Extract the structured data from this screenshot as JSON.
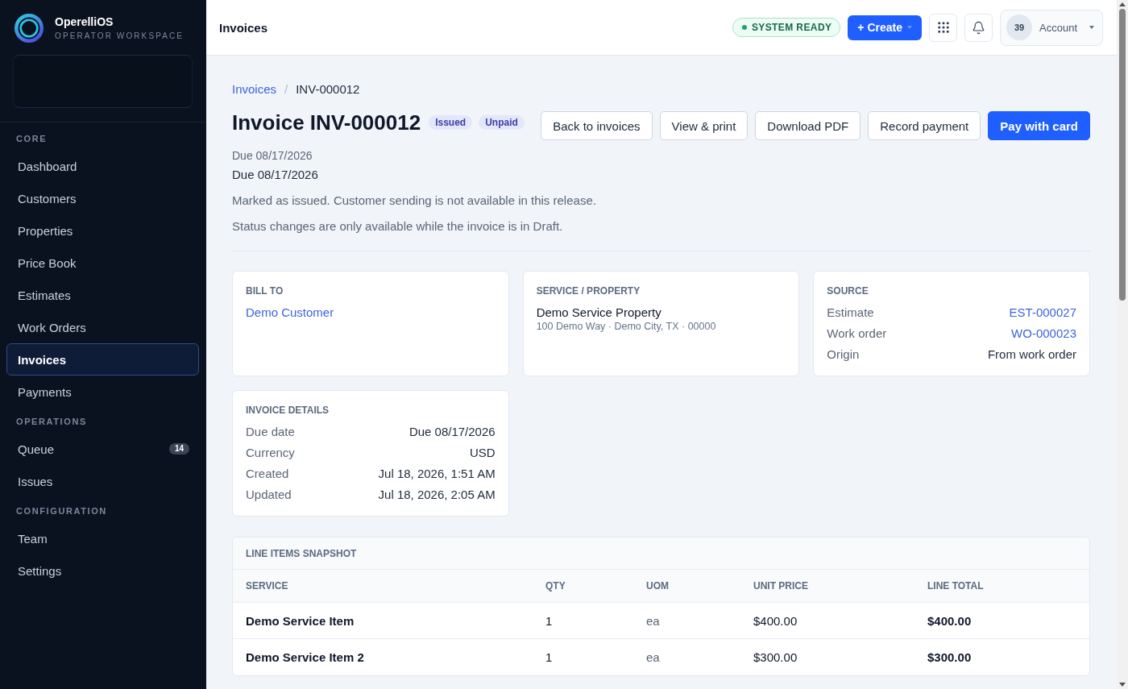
{
  "sidebar": {
    "brand": {
      "name": "OperelliOS",
      "tagline": "OPERATOR WORKSPACE"
    },
    "sections": [
      {
        "heading": "CORE",
        "items": [
          {
            "label": "Dashboard",
            "selected": false
          },
          {
            "label": "Customers",
            "selected": false
          },
          {
            "label": "Properties",
            "selected": false
          },
          {
            "label": "Price Book",
            "selected": false
          },
          {
            "label": "Estimates",
            "selected": false
          },
          {
            "label": "Work Orders",
            "selected": false
          },
          {
            "label": "Invoices",
            "selected": true
          },
          {
            "label": "Payments",
            "selected": false
          }
        ]
      },
      {
        "heading": "OPERATIONS",
        "items": [
          {
            "label": "Queue",
            "selected": false,
            "badge": "14"
          },
          {
            "label": "Issues",
            "selected": false
          }
        ]
      },
      {
        "heading": "CONFIGURATION",
        "items": [
          {
            "label": "Team",
            "selected": false
          },
          {
            "label": "Settings",
            "selected": false
          }
        ]
      }
    ]
  },
  "topbar": {
    "title": "Invoices",
    "status": "SYSTEM READY",
    "create_button": "+ Create",
    "account": {
      "avatar": "39",
      "label": "Account"
    }
  },
  "breadcrumb": {
    "separator": "/",
    "items": [
      {
        "label": "Invoices",
        "kind": "link"
      },
      {
        "label": "INV-000012",
        "kind": "current"
      }
    ]
  },
  "header": {
    "title": "Invoice INV-000012",
    "badges": [
      "Issued",
      "Unpaid"
    ],
    "actions": [
      {
        "label": "Back to invoices",
        "kind": "secondary"
      },
      {
        "label": "View & print",
        "kind": "secondary"
      },
      {
        "label": "Download PDF",
        "kind": "secondary"
      },
      {
        "label": "Record payment",
        "kind": "secondary"
      },
      {
        "label": "Pay with card",
        "kind": "primary"
      }
    ],
    "due_caption": "Due 08/17/2026",
    "due": "Due 08/17/2026",
    "notes": [
      "Marked as issued. Customer sending is not available in this release.",
      "Status changes are only available while the invoice is in Draft."
    ]
  },
  "bill_to": {
    "heading": "BILL TO",
    "customer": "Demo Customer"
  },
  "service_property": {
    "heading": "SERVICE / PROPERTY",
    "name": "Demo Service Property",
    "address": "100 Demo Way · Demo City, TX · 00000"
  },
  "source": {
    "heading": "SOURCE",
    "rows": [
      {
        "label": "Estimate",
        "value": "EST-000027",
        "kind": "link"
      },
      {
        "label": "Work order",
        "value": "WO-000023",
        "kind": "link"
      },
      {
        "label": "Origin",
        "value": "From work order",
        "kind": "text"
      }
    ]
  },
  "invoice_details": {
    "heading": "INVOICE DETAILS",
    "rows": [
      {
        "label": "Due date",
        "value": "Due 08/17/2026",
        "kind": "text"
      },
      {
        "label": "Currency",
        "value": "USD",
        "kind": "text"
      },
      {
        "label": "Created",
        "value": "Jul 18, 2026, 1:51 AM",
        "kind": "text"
      },
      {
        "label": "Updated",
        "value": "Jul 18, 2026, 2:05 AM",
        "kind": "text"
      }
    ]
  },
  "line_items": {
    "heading": "LINE ITEMS SNAPSHOT",
    "columns": [
      "SERVICE",
      "QTY",
      "UOM",
      "UNIT PRICE",
      "LINE TOTAL"
    ],
    "rows": [
      [
        "Demo Service Item",
        "1",
        "ea",
        "$400.00",
        "$400.00"
      ],
      [
        "Demo Service Item 2",
        "1",
        "ea",
        "$300.00",
        "$300.00"
      ]
    ]
  }
}
